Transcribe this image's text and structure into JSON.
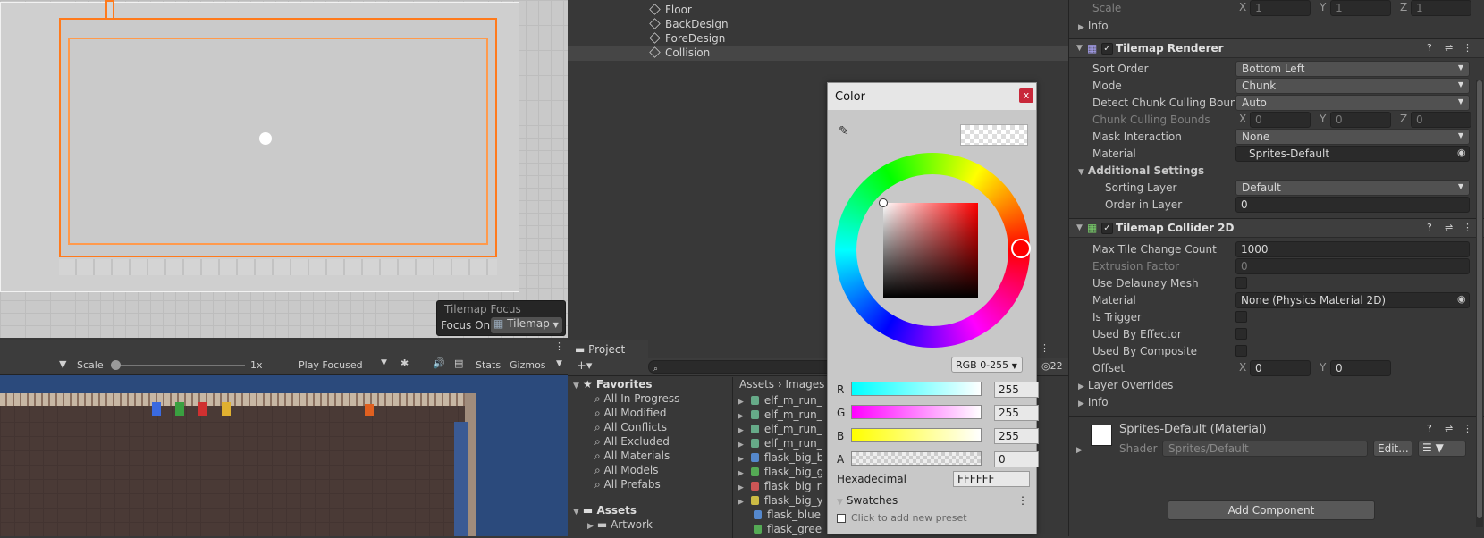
{
  "scene": {
    "focus_title": "Tilemap Focus",
    "focus_label": "Focus On",
    "focus_value": "Tilemap"
  },
  "gamebar": {
    "scale_label": "Scale",
    "scale_value": "1x",
    "play_focused": "Play Focused",
    "stats": "Stats",
    "gizmos": "Gizmos"
  },
  "hierarchy": {
    "items": [
      "Floor",
      "BackDesign",
      "ForeDesign",
      "Collision"
    ]
  },
  "project": {
    "tab": "Project",
    "hidden_count": "22",
    "favorites_label": "Favorites",
    "favorites": [
      "All In Progress",
      "All Modified",
      "All Conflicts",
      "All Excluded",
      "All Materials",
      "All Models",
      "All Prefabs"
    ],
    "assets_label": "Assets",
    "assets_children": [
      "Artwork"
    ],
    "breadcrumb": [
      "Assets",
      "Images"
    ],
    "files": [
      "elf_m_run_an",
      "elf_m_run_an",
      "elf_m_run_an",
      "elf_m_run_an",
      "flask_big_blu",
      "flask_big_gr",
      "flask_big_re",
      "flask_big_ye",
      "flask_blue",
      "flask_green"
    ]
  },
  "picker": {
    "title": "Color",
    "close": "x",
    "mode": "RGB 0-255",
    "channels": [
      {
        "label": "R",
        "value": "255"
      },
      {
        "label": "G",
        "value": "255"
      },
      {
        "label": "B",
        "value": "255"
      },
      {
        "label": "A",
        "value": "0"
      }
    ],
    "hex_label": "Hexadecimal",
    "hex_value": "FFFFFF",
    "swatches_label": "Swatches",
    "swatches_hint": "Click to add new preset"
  },
  "inspector": {
    "scale": {
      "label": "Scale",
      "x": "1",
      "y": "1",
      "z": "1"
    },
    "info_label": "Info",
    "renderer": {
      "title": "Tilemap Renderer",
      "sort_order": {
        "label": "Sort Order",
        "value": "Bottom Left"
      },
      "mode": {
        "label": "Mode",
        "value": "Chunk"
      },
      "culling": {
        "label": "Detect Chunk Culling Bounds",
        "value": "Auto"
      },
      "culling_bounds": {
        "label": "Chunk Culling Bounds",
        "x": "0",
        "y": "0",
        "z": "0"
      },
      "mask": {
        "label": "Mask Interaction",
        "value": "None"
      },
      "material": {
        "label": "Material",
        "value": "Sprites-Default"
      },
      "additional": "Additional Settings",
      "sorting_layer": {
        "label": "Sorting Layer",
        "value": "Default"
      },
      "order": {
        "label": "Order in Layer",
        "value": "0"
      }
    },
    "collider": {
      "title": "Tilemap Collider 2D",
      "max_tile": {
        "label": "Max Tile Change Count",
        "value": "1000"
      },
      "extrusion": {
        "label": "Extrusion Factor",
        "value": "0"
      },
      "delaunay": "Use Delaunay Mesh",
      "material": {
        "label": "Material",
        "value": "None (Physics Material 2D)"
      },
      "is_trigger": "Is Trigger",
      "effector": "Used By Effector",
      "composite": "Used By Composite",
      "offset": {
        "label": "Offset",
        "x": "0",
        "y": "0"
      },
      "layer_overrides": "Layer Overrides",
      "info": "Info"
    },
    "material_block": {
      "name": "Sprites-Default (Material)",
      "shader_label": "Shader",
      "shader_value": "Sprites/Default",
      "edit": "Edit..."
    },
    "add_component": "Add Component"
  }
}
